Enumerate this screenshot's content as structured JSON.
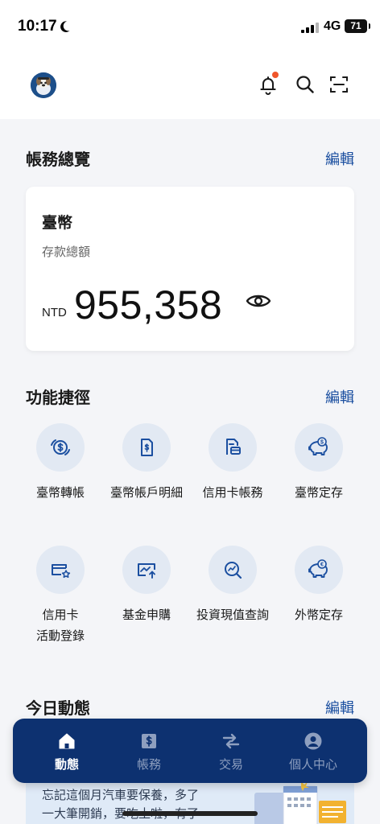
{
  "status": {
    "time": "10:17",
    "network": "4G",
    "battery": "71"
  },
  "header": {
    "icons": [
      "avatar",
      "bell-icon",
      "search-icon",
      "scan-icon"
    ],
    "notification_dot_color": "#f0562b"
  },
  "overview": {
    "title": "帳務總覽",
    "edit": "編輯",
    "card": {
      "title": "臺幣",
      "subtitle": "存款總額",
      "currency": "NTD",
      "amount": "955,358"
    }
  },
  "shortcuts": {
    "title": "功能捷徑",
    "edit": "編輯",
    "items": [
      {
        "label": "臺幣轉帳",
        "icon": "dollar-exchange-icon"
      },
      {
        "label": "臺幣帳戶明細",
        "icon": "dollar-document-icon"
      },
      {
        "label": "信用卡帳務",
        "icon": "card-statement-icon"
      },
      {
        "label": "臺幣定存",
        "icon": "piggy-bank-dollar-icon"
      },
      {
        "label": "信用卡",
        "label2": "活動登錄",
        "icon": "card-star-icon"
      },
      {
        "label": "基金申購",
        "icon": "fund-chart-icon"
      },
      {
        "label": "投資現值查詢",
        "icon": "investment-search-icon"
      },
      {
        "label": "外幣定存",
        "icon": "piggy-bank-euro-icon"
      }
    ]
  },
  "today": {
    "title": "今日動態",
    "edit": "編輯",
    "promo_line1": "忘記這個月汽車要保養，多了",
    "promo_line2": "一大筆開銷，要吃土啦，有了"
  },
  "nav": {
    "items": [
      {
        "label": "動態",
        "icon": "home-icon",
        "active": true
      },
      {
        "label": "帳務",
        "icon": "dollar-doc-icon",
        "active": false
      },
      {
        "label": "交易",
        "icon": "transfer-arrows-icon",
        "active": false
      },
      {
        "label": "個人中心",
        "icon": "user-icon",
        "active": false
      }
    ]
  },
  "colors": {
    "accent": "#1b4fa0",
    "nav_bg": "#0d3170",
    "icon_circle": "#e2e9f3",
    "icon_stroke": "#1b4fa0"
  }
}
